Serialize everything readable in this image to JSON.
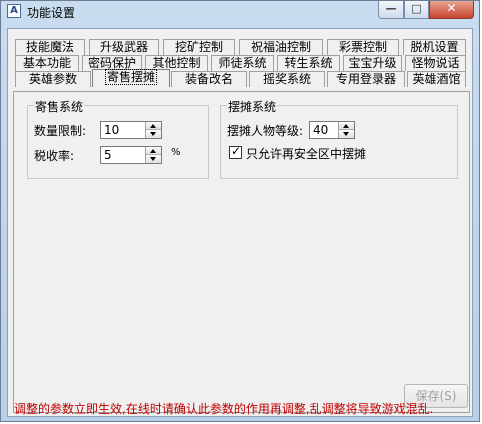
{
  "window": {
    "title": "功能设置",
    "app_icon_glyph": "A",
    "controls": {
      "minimize": "—",
      "maximize": "□",
      "close": "✕"
    }
  },
  "tabs": {
    "row1": [
      "技能魔法",
      "升级武器",
      "挖矿控制",
      "祝福油控制",
      "彩票控制",
      "脱机设置"
    ],
    "row2": [
      "基本功能",
      "密码保护",
      "其他控制",
      "师徒系统",
      "转生系统",
      "宝宝升级",
      "怪物说话"
    ],
    "row3": [
      "英雄参数",
      "寄售摆摊",
      "装备改名",
      "摇奖系统",
      "专用登录器",
      "英雄酒馆"
    ],
    "active": "寄售摆摊"
  },
  "consign": {
    "title": "寄售系统",
    "limit_label": "数量限制:",
    "limit_value": "10",
    "tax_label": "税收率:",
    "tax_value": "5",
    "tax_unit": "%"
  },
  "stall": {
    "title": "摆摊系统",
    "level_label": "摆摊人物等级:",
    "level_value": "40",
    "safezone_label": "只允许再安全区中摆摊",
    "safezone_checked": true
  },
  "save_button": "保存(S)",
  "notice": "调整的参数立即生效,在线时请确认此参数的作用再调整,乱调整将导致游戏混乱."
}
